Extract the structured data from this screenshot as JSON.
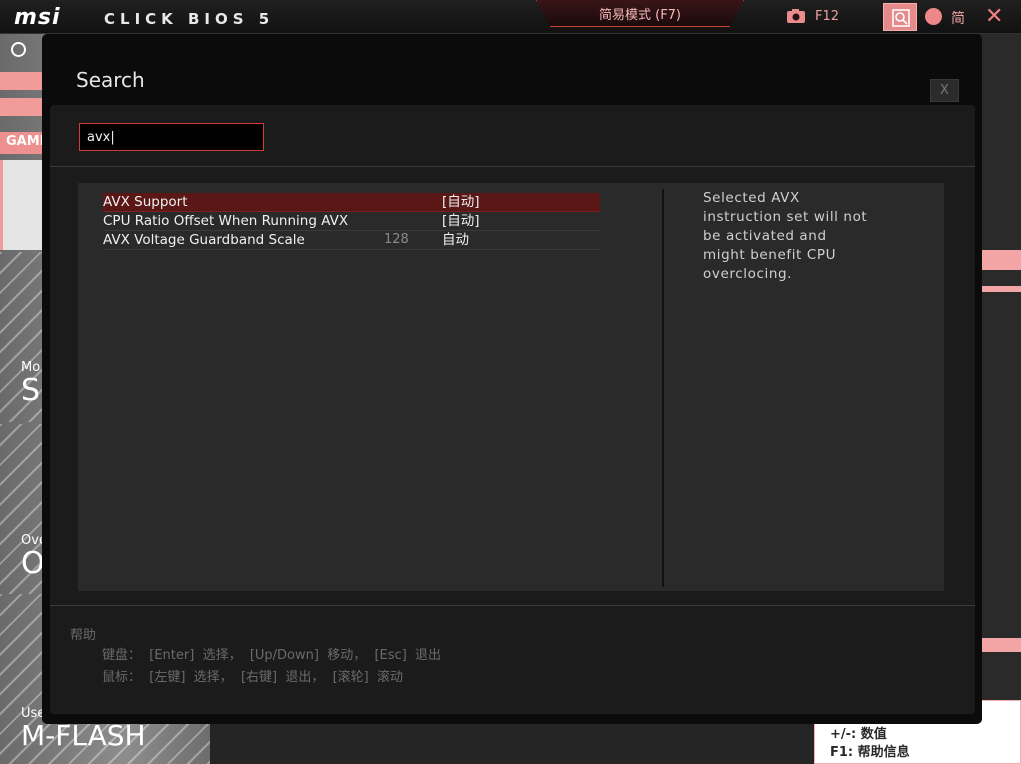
{
  "header": {
    "brand": "msi",
    "product": "CLICK BIOS 5",
    "ez_mode": "简易模式 (F7)",
    "screenshot_key": "F12",
    "language": "简"
  },
  "background": {
    "tab_game": "GAMI",
    "sections": [
      {
        "small": "Mo",
        "big": "SI"
      },
      {
        "small": "Ove",
        "big": "O"
      },
      {
        "small": "Use",
        "big": "M-FLASH"
      }
    ],
    "hints": [
      "+/-: 数值",
      "F1: 帮助信息"
    ]
  },
  "dialog": {
    "title": "Search",
    "close_label": "X",
    "search": {
      "value": "avx|"
    },
    "results": [
      {
        "name": "AVX Support",
        "num": "",
        "value": "[自动]",
        "selected": true
      },
      {
        "name": "CPU Ratio Offset When Running AVX",
        "num": "",
        "value": "[自动]",
        "selected": false
      },
      {
        "name": "AVX Voltage Guardband Scale",
        "num": "128",
        "value": "自动",
        "selected": false
      }
    ],
    "help_description": "Selected AVX instruction set will not be activated and might benefit CPU overclocing.",
    "footer": {
      "title": "帮助",
      "keyboard": "键盘：  [Enter]  选择，  [Up/Down]  移动，  [Esc]  退出",
      "mouse": "鼠标：  [左键]  选择，  [右键]  退出，  [滚轮]  滚动"
    }
  }
}
